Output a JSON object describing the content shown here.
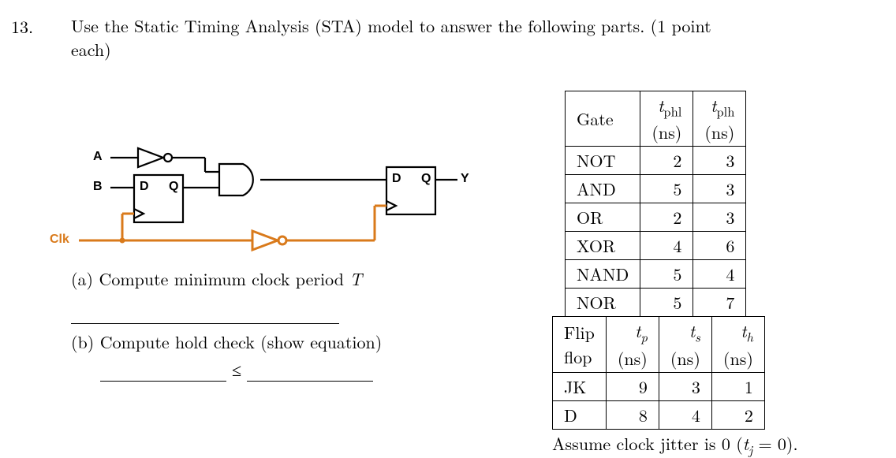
{
  "question": {
    "number": "13.",
    "text_line1": "Use the Static Timing Analysis (STA) model to answer the following parts.  (1 point",
    "text_line2": "each)"
  },
  "circuit": {
    "labels": {
      "A": "A",
      "B": "B",
      "Clk": "Clk",
      "D1": "D",
      "Q1": "Q",
      "D2": "D",
      "Q2": "Q",
      "Y": "Y"
    }
  },
  "parts": {
    "a": {
      "label": "(a)",
      "text": "Compute minimum clock period",
      "symbol": "T"
    },
    "b": {
      "label": "(b)",
      "text": "Compute hold check (show equation)",
      "rel": "≤"
    }
  },
  "gate_table": {
    "headers": {
      "gate": "Gate",
      "tphl": "t",
      "tphl_sub": "phl",
      "tphl_unit": "(ns)",
      "tplh": "t",
      "tplh_sub": "plh",
      "tplh_unit": "(ns)"
    },
    "rows": [
      {
        "name": "NOT",
        "tphl": 2,
        "tplh": 3
      },
      {
        "name": "AND",
        "tphl": 5,
        "tplh": 3
      },
      {
        "name": "OR",
        "tphl": 2,
        "tplh": 3
      },
      {
        "name": "XOR",
        "tphl": 4,
        "tplh": 6
      },
      {
        "name": "NAND",
        "tphl": 5,
        "tplh": 4
      },
      {
        "name": "NOR",
        "tphl": 5,
        "tplh": 7
      }
    ]
  },
  "ff_table": {
    "headers": {
      "ff": "Flip flop",
      "ff_l1": "Flip",
      "ff_l2": "flop",
      "tp": "t",
      "tp_sub": "p",
      "tp_unit": "(ns)",
      "ts": "t",
      "ts_sub": "s",
      "ts_unit": "(ns)",
      "th": "t",
      "th_sub": "h",
      "th_unit": "(ns)"
    },
    "rows": [
      {
        "name": "JK",
        "tp": 9,
        "ts": 3,
        "th": 1
      },
      {
        "name": "D",
        "tp": 8,
        "ts": 4,
        "th": 2
      }
    ]
  },
  "note": {
    "pre": "Assume clock jitter is 0 (",
    "sym": "t",
    "sym_sub": "j",
    "post": " = 0)."
  },
  "chart_data": {
    "type": "table",
    "tables": [
      {
        "title": "Gate propagation delays",
        "columns": [
          "Gate",
          "t_phl (ns)",
          "t_plh (ns)"
        ],
        "rows": [
          [
            "NOT",
            2,
            3
          ],
          [
            "AND",
            5,
            3
          ],
          [
            "OR",
            2,
            3
          ],
          [
            "XOR",
            4,
            6
          ],
          [
            "NAND",
            5,
            4
          ],
          [
            "NOR",
            5,
            7
          ]
        ]
      },
      {
        "title": "Flip-flop timing",
        "columns": [
          "Flip flop",
          "t_p (ns)",
          "t_s (ns)",
          "t_h (ns)"
        ],
        "rows": [
          [
            "JK",
            9,
            3,
            1
          ],
          [
            "D",
            8,
            4,
            2
          ]
        ]
      }
    ]
  }
}
